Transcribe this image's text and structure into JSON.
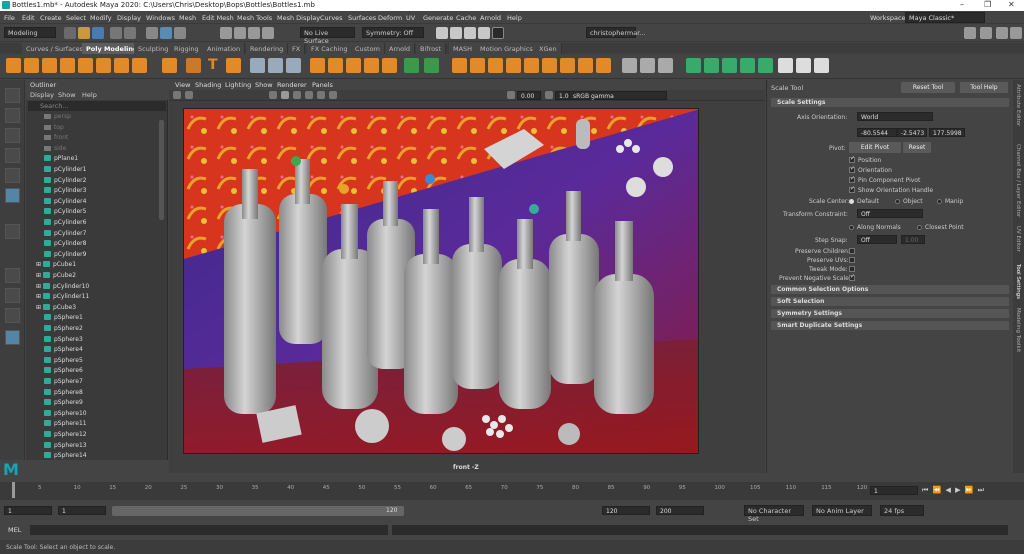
{
  "window": {
    "title": "Bottles1.mb* - Autodesk Maya 2020: C:\\Users\\Chris\\Desktop\\Bops\\Bottles\\Bottles1.mb"
  },
  "menubar": {
    "items": [
      "File",
      "Edit",
      "Create",
      "Select",
      "Modify",
      "Display",
      "Windows",
      "Mesh",
      "Edit Mesh",
      "Mesh Tools",
      "Mesh Display",
      "Curves",
      "Surfaces",
      "Deform",
      "UV",
      "Generate",
      "Cache",
      "Arnold",
      "Help"
    ]
  },
  "workspace": {
    "label": "Workspace :",
    "value": "Maya Classic*"
  },
  "statusline": {
    "mode": "Modeling",
    "live_surface": "No Live Surface",
    "symmetry": "Symmetry: Off",
    "user": "christophermar..."
  },
  "shelf_tabs": [
    "Curves / Surfaces",
    "Poly Modeling",
    "Sculpting",
    "Rigging",
    "Animation",
    "Rendering",
    "FX",
    "FX Caching",
    "Custom",
    "Arnold",
    "Bifrost",
    "MASH",
    "Motion Graphics",
    "XGen"
  ],
  "shelf_active": "Poly Modeling",
  "outliner": {
    "title": "Outliner",
    "menu": [
      "Display",
      "Show",
      "Help"
    ],
    "search_placeholder": "Search...",
    "items": [
      "persp",
      "top",
      "front",
      "side",
      "pPlane1",
      "pCylinder1",
      "pCylinder2",
      "pCylinder3",
      "pCylinder4",
      "pCylinder5",
      "pCylinder6",
      "pCylinder7",
      "pCylinder8",
      "pCylinder9",
      "pCube1",
      "pCube2",
      "pCylinder10",
      "pCylinder11",
      "pCube3",
      "pSphere1",
      "pSphere2",
      "pSphere3",
      "pSphere4",
      "pSphere5",
      "pSphere6",
      "pSphere7",
      "pSphere8",
      "pSphere9",
      "pSphere10",
      "pSphere11",
      "pSphere12",
      "pSphere13",
      "pSphere14"
    ]
  },
  "viewport": {
    "menu": [
      "View",
      "Shading",
      "Lighting",
      "Show",
      "Renderer",
      "Panels"
    ],
    "exposure": "0.00",
    "gamma": "1.00",
    "colorspace": "sRGB gamma",
    "camera_label": "front -Z"
  },
  "attr": {
    "tool_title": "Scale Tool",
    "reset_button": "Reset Tool",
    "help_button": "Tool Help",
    "section_scale": "Scale Settings",
    "axis_orientation_label": "Axis Orientation:",
    "axis_orientation_value": "World",
    "pivot_values": [
      "-80.5544",
      "-2.5473",
      "177.5998"
    ],
    "pivot_label": "Pivot:",
    "edit_pivot": "Edit Pivot",
    "reset": "Reset",
    "pivot_checks": [
      "Position",
      "Orientation",
      "Pin Component Pivot",
      "Show Orientation Handle"
    ],
    "scale_center_label": "Scale Center:",
    "scale_center_options": [
      "Default",
      "Object",
      "Manip"
    ],
    "transform_constraint_label": "Transform Constraint:",
    "transform_constraint_value": "Off",
    "along_normals": "Along Normals",
    "closest_point": "Closest Point",
    "step_snap_label": "Step Snap:",
    "step_snap_value": "Off",
    "step_snap_num": "1.00",
    "preserve_children": "Preserve Children:",
    "preserve_uvs": "Preserve UVs:",
    "tweak_mode": "Tweak Mode:",
    "prevent_negative": "Prevent Negative Scale:",
    "sections": [
      "Common Selection Options",
      "Soft Selection",
      "Symmetry Settings",
      "Smart Duplicate Settings"
    ]
  },
  "right_strip": [
    "Modeling Toolkit",
    "Tool Settings",
    "UV Editor",
    "Channel Box / Layer Editor",
    "Attribute Editor"
  ],
  "timeslider": {
    "ticks": [
      "5",
      "10",
      "15",
      "20",
      "25",
      "30",
      "35",
      "40",
      "45",
      "50",
      "55",
      "60",
      "65",
      "70",
      "75",
      "80",
      "85",
      "90",
      "95",
      "100",
      "105",
      "110",
      "115",
      "120"
    ],
    "current": "1"
  },
  "range": {
    "start": "1",
    "start2": "1",
    "handle": "120",
    "end1": "120",
    "end2": "200",
    "character_set": "No Character Set",
    "anim_layer": "No Anim Layer",
    "fps": "24 fps"
  },
  "cmdline": {
    "label": "MEL"
  },
  "helpline": {
    "text": "Scale Tool: Select an object to scale."
  },
  "colors": {
    "accent": "#5d5d5d",
    "shelf_icon": "#e08a2a",
    "highlight": "#5285a6"
  }
}
